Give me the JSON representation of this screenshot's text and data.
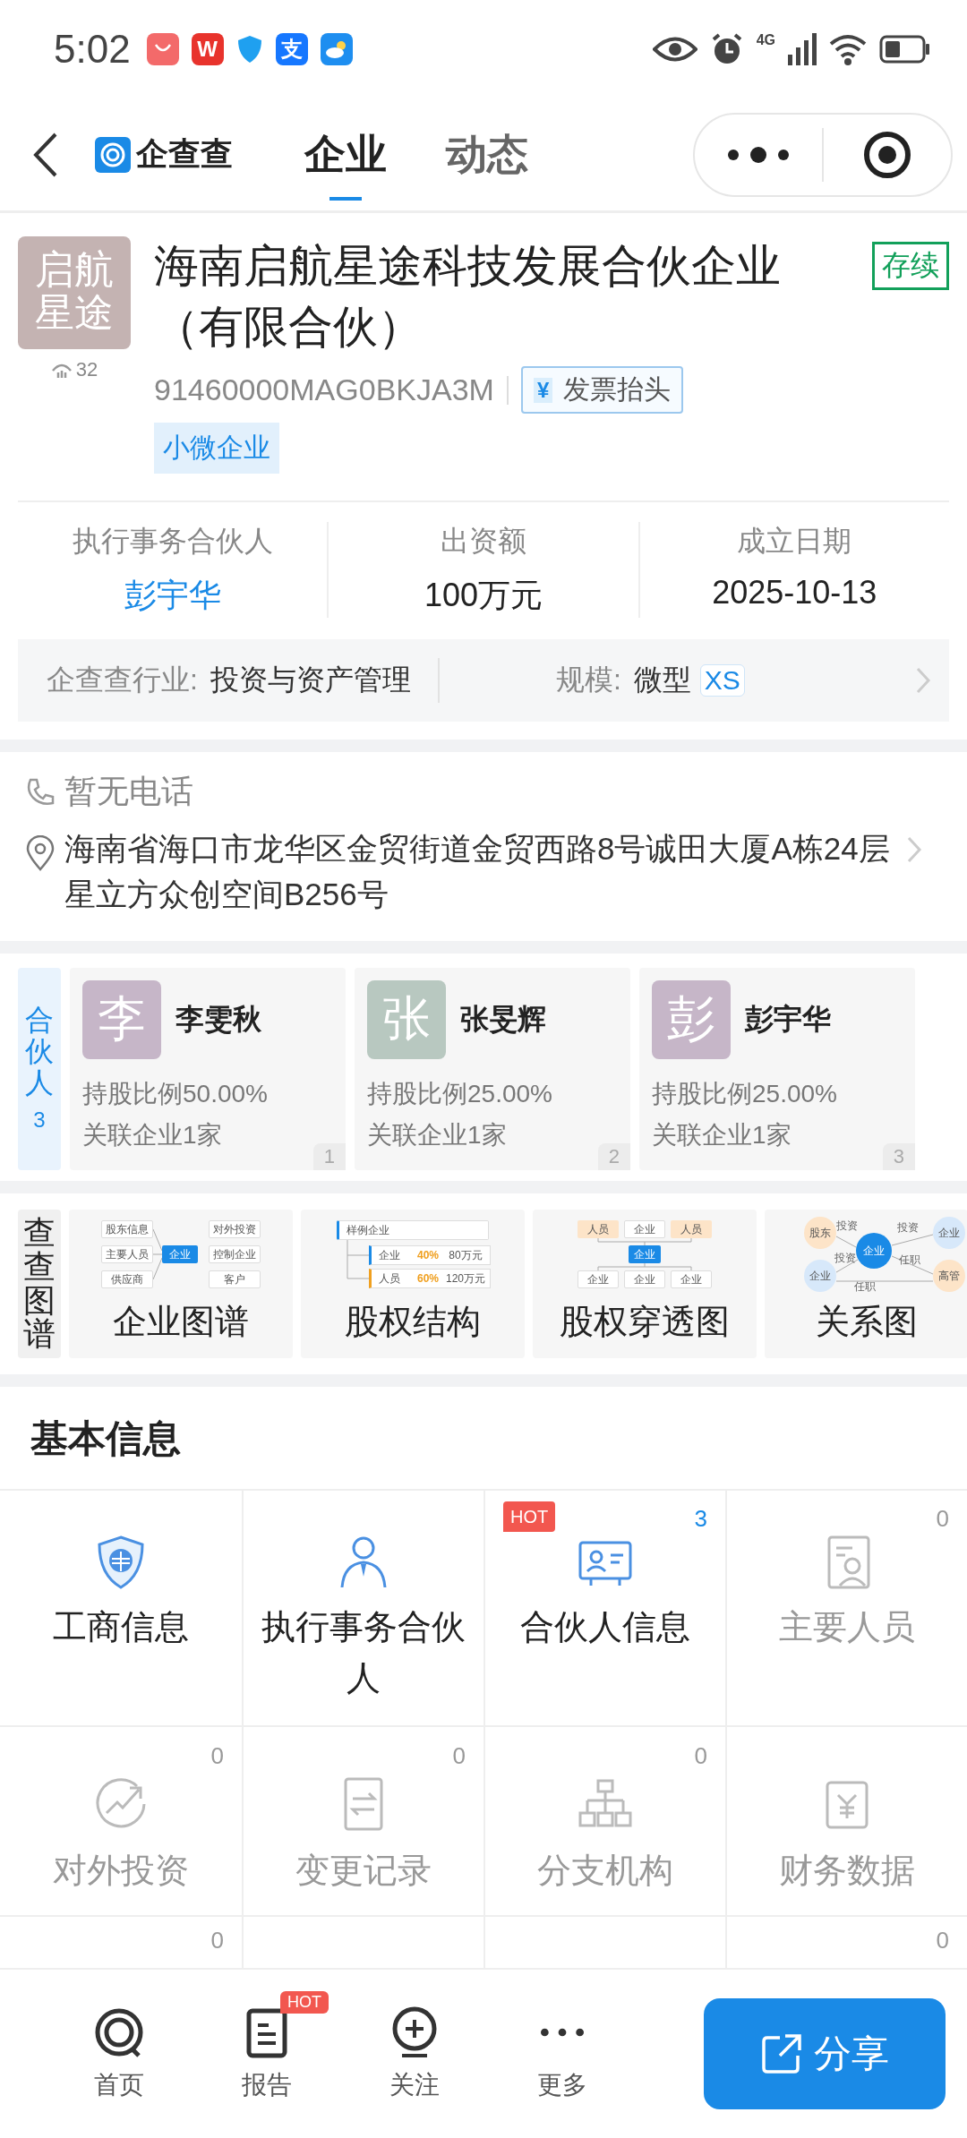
{
  "status_bar": {
    "time": "5:02",
    "apps": [
      {
        "kind": "bag"
      },
      {
        "kind": "letter",
        "label": "W"
      },
      {
        "kind": "shield"
      },
      {
        "kind": "letter",
        "label": "支"
      },
      {
        "kind": "weather"
      }
    ],
    "network": "4G"
  },
  "nav": {
    "logo": "企查查",
    "tabs": [
      {
        "label": "企业",
        "selected": true
      },
      {
        "label": "动态",
        "selected": false
      }
    ]
  },
  "company": {
    "avatar": [
      "启航",
      "星途"
    ],
    "followers": "32",
    "name": "海南启航星途科技发展合伙企业（有限合伙）",
    "status": "存续",
    "credit_code": "91460000MAG0BKJA3M",
    "invoice": {
      "icon": "¥",
      "label": "发票抬头"
    },
    "tags": [
      "小微企业"
    ],
    "stats": [
      {
        "label": "执行事务合伙人",
        "value": "彭宇华",
        "kind": "link"
      },
      {
        "label": "出资额",
        "value": "100万元",
        "kind": "plain"
      },
      {
        "label": "成立日期",
        "value": "2025-10-13",
        "kind": "plain"
      }
    ],
    "industry": {
      "label": "企查查行业:",
      "value": "投资与资产管理",
      "scale_label": "规模:",
      "scale_value": "微型",
      "scale_badge": "XS"
    }
  },
  "contact": {
    "phone": "暂无电话",
    "address": "海南省海口市龙华区金贸街道金贸西路8号诚田大厦A栋24层星立方众创空间B256号"
  },
  "partners": {
    "label": "合伙人",
    "count": "3",
    "items": [
      {
        "avatar": "李",
        "color": "#c6b6c8",
        "name": "李雯秋",
        "share": "持股比例50.00%",
        "related": "关联企业1家",
        "index": "1"
      },
      {
        "avatar": "张",
        "color": "#b8c8c0",
        "name": "张旻辉",
        "share": "持股比例25.00%",
        "related": "关联企业1家",
        "index": "2"
      },
      {
        "avatar": "彭",
        "color": "#c6b6c8",
        "name": "彭宇华",
        "share": "持股比例25.00%",
        "related": "关联企业1家",
        "index": "3"
      }
    ]
  },
  "graphs": {
    "label": "查查图谱",
    "cards": [
      {
        "kind": "map",
        "title": "企业图谱",
        "nodes": [
          {
            "text": "股东信息",
            "kind": "box"
          },
          {
            "text": "主要人员",
            "kind": "box"
          },
          {
            "text": "供应商",
            "kind": "box"
          },
          {
            "text": "企业",
            "kind": "hub"
          },
          {
            "text": "对外投资",
            "kind": "box"
          },
          {
            "text": "控制企业",
            "kind": "box"
          },
          {
            "text": "客户",
            "kind": "box"
          }
        ]
      },
      {
        "kind": "structure",
        "title": "股权结构",
        "nodes": [
          {
            "text": "样例企业",
            "kind": "bar"
          },
          {
            "text": "企业",
            "kind": "plain"
          },
          {
            "text": "40%",
            "kind": "pct"
          },
          {
            "text": "80万元",
            "kind": "plain"
          },
          {
            "text": "人员",
            "kind": "plain"
          },
          {
            "text": "60%",
            "kind": "pct"
          },
          {
            "text": "120万元",
            "kind": "plain"
          }
        ]
      },
      {
        "kind": "penetration",
        "title": "股权穿透图",
        "nodes": [
          {
            "text": "人员",
            "kind": "orange"
          },
          {
            "text": "企业",
            "kind": "box"
          },
          {
            "text": "人员",
            "kind": "orange"
          },
          {
            "text": "企业",
            "kind": "hub"
          },
          {
            "text": "企业",
            "kind": "box"
          },
          {
            "text": "企业",
            "kind": "box"
          },
          {
            "text": "企业",
            "kind": "box"
          }
        ]
      },
      {
        "kind": "relation",
        "title": "关系图",
        "nodes": [
          {
            "text": "股东",
            "kind": "orange-circle"
          },
          {
            "text": "企业",
            "kind": "blue-circle"
          },
          {
            "text": "企业",
            "kind": "hub-circle"
          },
          {
            "text": "投资",
            "kind": "edge"
          },
          {
            "text": "投资",
            "kind": "edge"
          },
          {
            "text": "投资",
            "kind": "edge"
          },
          {
            "text": "任职",
            "kind": "edge"
          },
          {
            "text": "任职",
            "kind": "edge"
          },
          {
            "text": "企业",
            "kind": "blue-circle"
          },
          {
            "text": "高管",
            "kind": "orange-circle"
          }
        ]
      }
    ]
  },
  "basic_info": {
    "title": "基本信息",
    "rows": [
      [
        {
          "kind": "item",
          "label": "工商信息",
          "disabled": false
        },
        {
          "kind": "item",
          "label": "执行事务合伙人",
          "disabled": false
        },
        {
          "kind": "item",
          "label": "合伙人信息",
          "disabled": false,
          "badge": "HOT",
          "count": "3"
        },
        {
          "kind": "item",
          "label": "主要人员",
          "disabled": true,
          "count": "0"
        }
      ],
      [
        {
          "kind": "item",
          "label": "对外投资",
          "disabled": true,
          "count": "0"
        },
        {
          "kind": "item",
          "label": "变更记录",
          "disabled": true,
          "count": "0"
        },
        {
          "kind": "item",
          "label": "分支机构",
          "disabled": true,
          "count": "0"
        },
        {
          "kind": "item",
          "label": "财务数据",
          "disabled": true
        }
      ],
      [
        {
          "kind": "count",
          "count": "0"
        },
        {
          "kind": "blank"
        },
        {
          "kind": "blank"
        },
        {
          "kind": "count",
          "count": "0"
        }
      ]
    ]
  },
  "bottom_nav": {
    "items": [
      {
        "label": "首页"
      },
      {
        "label": "报告",
        "badge": "HOT"
      },
      {
        "label": "关注"
      },
      {
        "label": "更多"
      }
    ],
    "share": "分享"
  }
}
